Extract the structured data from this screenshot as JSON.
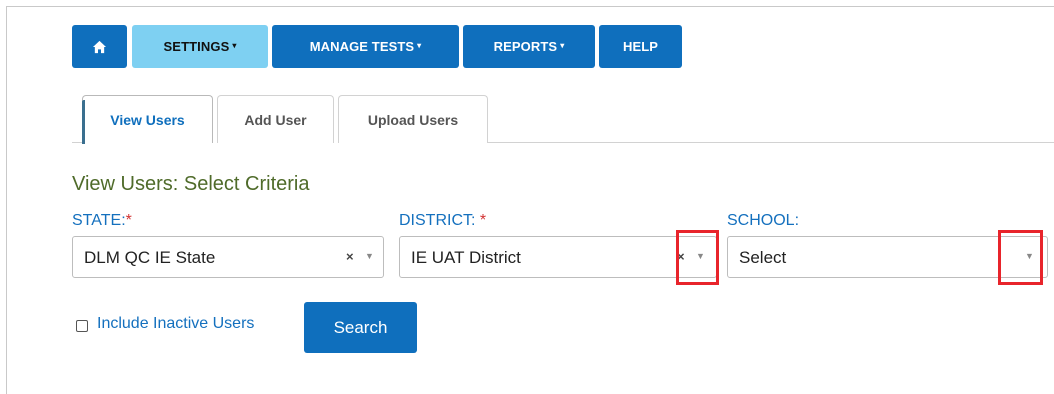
{
  "nav": {
    "settings": "SETTINGS",
    "manage_tests": "MANAGE TESTS",
    "reports": "REPORTS",
    "help": "HELP",
    "dropdown_caret": "▾"
  },
  "tabs": {
    "view_users": "View Users",
    "add_user": "Add User",
    "upload_users": "Upload Users",
    "active": "View Users"
  },
  "section": {
    "heading": "View Users: Select Criteria"
  },
  "filters": {
    "state": {
      "label": "STATE:",
      "required_marker": "*",
      "value": "DLM QC IE State",
      "clear": "×",
      "arrow": "▼"
    },
    "district": {
      "label": "DISTRICT: ",
      "required_marker": "*",
      "value": "IE UAT District",
      "clear": "×",
      "arrow": "▼"
    },
    "school": {
      "label": "SCHOOL:",
      "value": "Select",
      "arrow": "▼"
    }
  },
  "options": {
    "include_inactive_label": "Include Inactive Users",
    "include_inactive_checked": false
  },
  "actions": {
    "search_label": "Search"
  },
  "colors": {
    "primary": "#0f6fbd",
    "active_nav": "#7ed0f2",
    "heading": "#4f6b2a",
    "label": "#1470be",
    "required": "#d23232",
    "highlight_box": "#e8242b"
  },
  "icons": {
    "home": "home-icon",
    "caret": "caret-down-icon",
    "clear": "clear-icon",
    "dropdown_arrow": "dropdown-arrow-icon"
  }
}
